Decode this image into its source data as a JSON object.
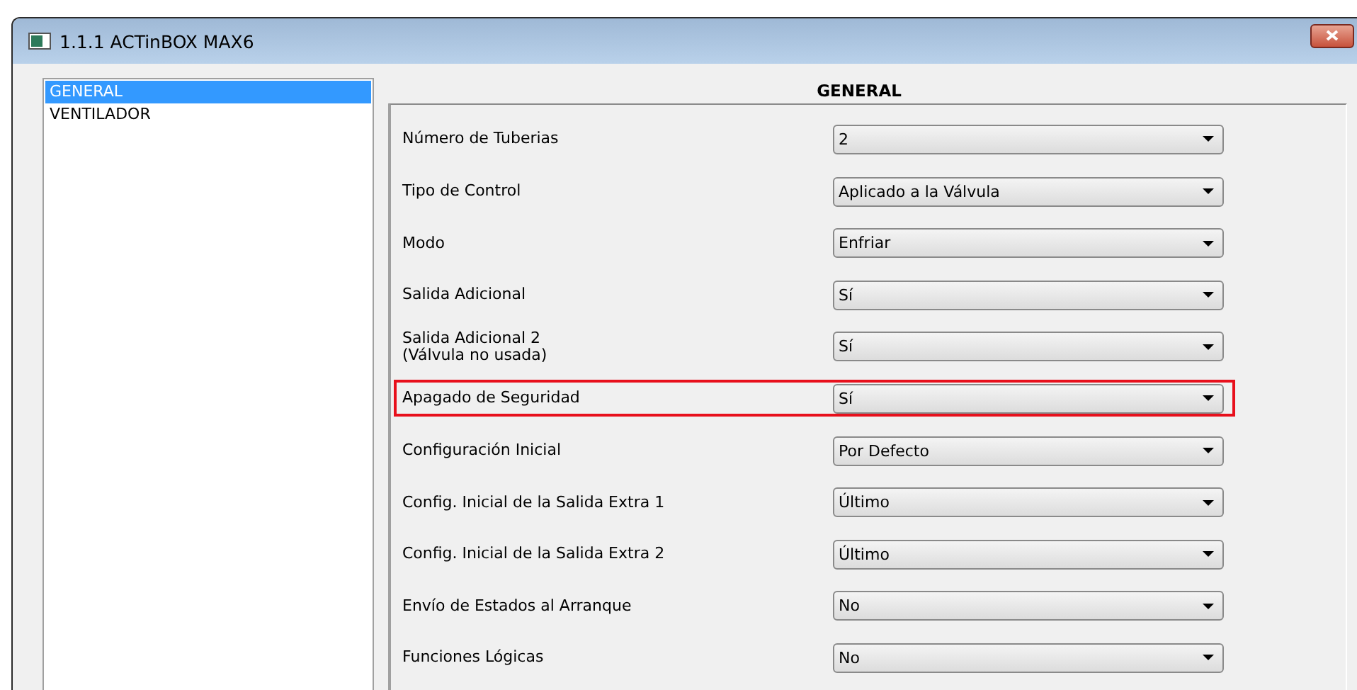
{
  "window": {
    "title": "1.1.1 ACTinBOX MAX6"
  },
  "sidebar": {
    "items": [
      {
        "label": "GENERAL",
        "selected": true
      },
      {
        "label": "VENTILADOR",
        "selected": false
      }
    ]
  },
  "section_title": "GENERAL",
  "parameters": [
    {
      "label": "Número de Tuberias",
      "value": "2",
      "highlighted": false
    },
    {
      "label": "Tipo de Control",
      "value": "Aplicado a la Válvula",
      "highlighted": false
    },
    {
      "label": "Modo",
      "value": "Enfriar",
      "highlighted": false
    },
    {
      "label": "Salida Adicional",
      "value": "Sí",
      "highlighted": false
    },
    {
      "label": "Salida Adicional 2\n(Válvula no usada)",
      "value": "Sí",
      "highlighted": false
    },
    {
      "label": "Apagado de Seguridad",
      "value": "Sí",
      "highlighted": true
    },
    {
      "label": "Configuración Inicial",
      "value": "Por Defecto",
      "highlighted": false
    },
    {
      "label": "Config. Inicial de la Salida Extra 1",
      "value": "Último",
      "highlighted": false
    },
    {
      "label": "Config. Inicial de la Salida Extra 2",
      "value": "Último",
      "highlighted": false
    },
    {
      "label": "Envío de Estados al Arranque",
      "value": "No",
      "highlighted": false
    },
    {
      "label": "Funciones Lógicas",
      "value": "No",
      "highlighted": false
    }
  ]
}
